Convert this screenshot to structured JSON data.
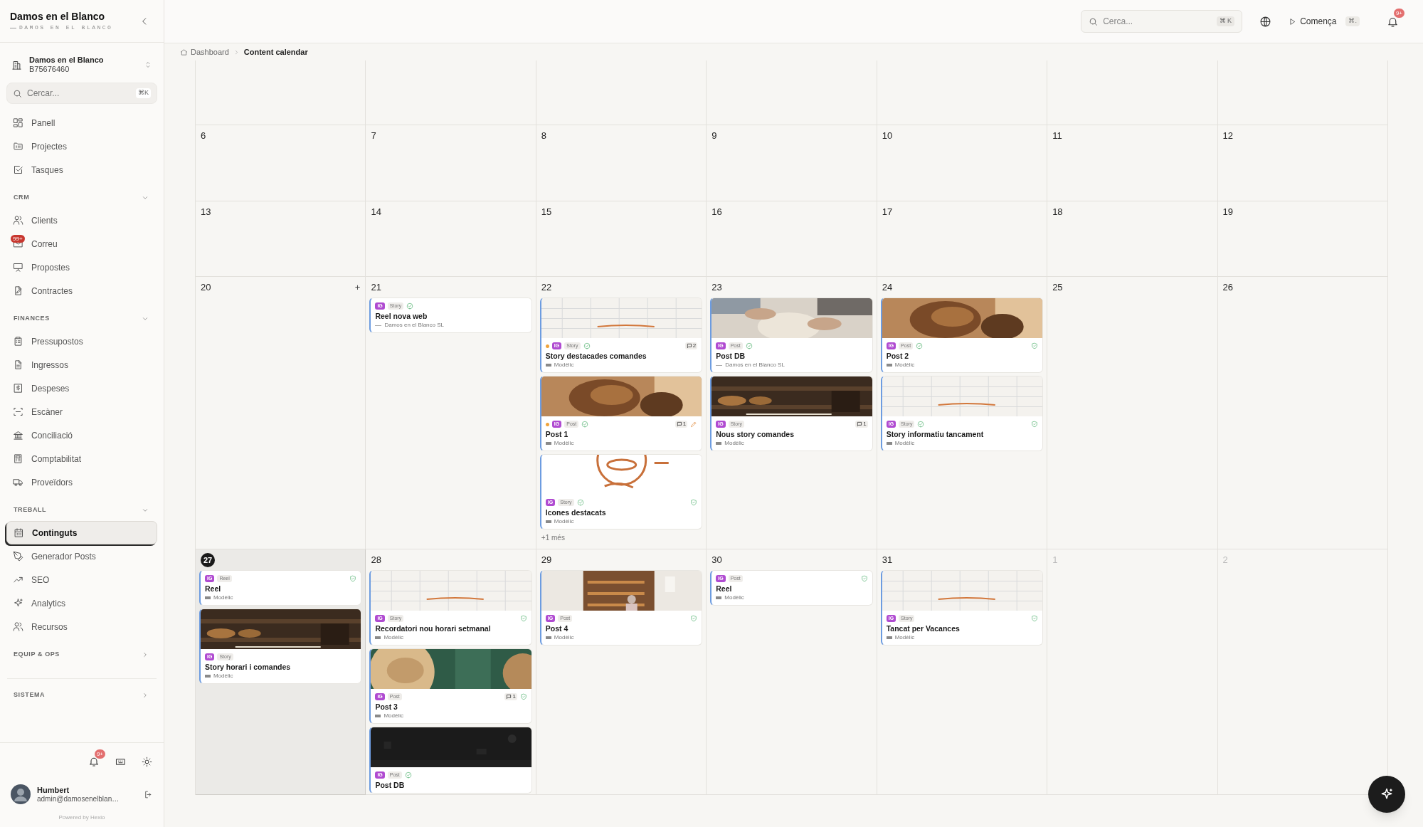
{
  "sidebar": {
    "brand": {
      "title": "Damos en el Blanco",
      "subtitle": "DAMOS EN EL BLANCO"
    },
    "org": {
      "name": "Damos en el Blanco",
      "id": "B75676460"
    },
    "search": {
      "placeholder": "Cercar...",
      "shortcut": "⌘K"
    },
    "items": [
      {
        "label": "Panell",
        "selected": false
      },
      {
        "label": "Projectes",
        "selected": false
      },
      {
        "label": "Tasques",
        "selected": false
      }
    ],
    "sections": [
      {
        "title": "CRM",
        "expanded": true,
        "items": [
          {
            "label": "Clients",
            "selected": false
          },
          {
            "label": "Correu",
            "selected": false,
            "badge": "99+"
          },
          {
            "label": "Propostes",
            "selected": false
          },
          {
            "label": "Contractes",
            "selected": false
          }
        ]
      },
      {
        "title": "FINANCES",
        "expanded": true,
        "items": [
          {
            "label": "Pressupostos",
            "selected": false
          },
          {
            "label": "Ingressos",
            "selected": false
          },
          {
            "label": "Despeses",
            "selected": false
          },
          {
            "label": "Escàner",
            "selected": false
          },
          {
            "label": "Conciliació",
            "selected": false
          },
          {
            "label": "Comptabilitat",
            "selected": false
          },
          {
            "label": "Proveïdors",
            "selected": false
          }
        ]
      },
      {
        "title": "TREBALL",
        "expanded": true,
        "items": [
          {
            "label": "Continguts",
            "selected": true
          },
          {
            "label": "Generador Posts",
            "selected": false
          },
          {
            "label": "SEO",
            "selected": false
          },
          {
            "label": "Analytics",
            "selected": false
          },
          {
            "label": "Recursos",
            "selected": false
          }
        ]
      },
      {
        "title": "EQUIP & OPS",
        "expanded": false
      },
      {
        "title": "SISTEMA",
        "expanded": false
      }
    ],
    "footer": {
      "notifications_badge": "9+",
      "user": {
        "name": "Humbert",
        "email": "admin@damosenelblan…"
      },
      "powered_by": "Powered by Hexio"
    }
  },
  "topbar": {
    "search": {
      "placeholder": "Cerca...",
      "shortcut": "⌘ K"
    },
    "start": {
      "label": "Comença",
      "shortcut": "⌘."
    },
    "notifications_badge": "9+"
  },
  "breadcrumb": [
    {
      "label": "Dashboard"
    },
    {
      "label": "Content calendar"
    }
  ],
  "calendar": {
    "weeks": [
      {
        "days": [
          {
            "day": "6"
          },
          {
            "day": "7"
          },
          {
            "day": "8"
          },
          {
            "day": "9"
          },
          {
            "day": "10"
          },
          {
            "day": "11"
          },
          {
            "day": "12"
          }
        ]
      },
      {
        "days": [
          {
            "day": "13"
          },
          {
            "day": "14"
          },
          {
            "day": "15"
          },
          {
            "day": "16"
          },
          {
            "day": "17"
          },
          {
            "day": "18"
          },
          {
            "day": "19"
          }
        ]
      },
      {
        "days": [
          {
            "day": "20",
            "add": "+"
          },
          {
            "day": "21",
            "cards": [
              {
                "platform": "IG",
                "type": "Story",
                "approved": true,
                "verified": false,
                "title": "Reel nova web",
                "client": {
                  "kind": "line",
                  "name": "Damos en el Blanco SL"
                }
              }
            ]
          },
          {
            "day": "22",
            "cards": [
              {
                "color": "#f0a43c",
                "platform": "IG",
                "type": "Story",
                "approved": true,
                "comments": "2",
                "verified": false,
                "title": "Story destacades comandes",
                "client": {
                  "kind": "logo",
                  "name": "Modèlic"
                }
              },
              {
                "color": "#f0a43c",
                "platform": "IG",
                "type": "Post",
                "approved": true,
                "comments": "1",
                "edited": true,
                "verified": false,
                "title": "Post 1",
                "client": {
                  "kind": "logo",
                  "name": "Modèlic"
                }
              },
              {
                "platform": "IG",
                "type": "Story",
                "approved": true,
                "verified": true,
                "title": "Icones destacats",
                "client": {
                  "kind": "logo",
                  "name": "Modèlic"
                }
              }
            ],
            "more": "+1 més"
          },
          {
            "day": "23",
            "cards": [
              {
                "platform": "IG",
                "type": "Post",
                "approved": true,
                "verified": false,
                "title": "Post DB",
                "client": {
                  "kind": "line",
                  "name": "Damos en el Blanco SL"
                }
              },
              {
                "platform": "IG",
                "type": "Story",
                "approved": false,
                "comments": "1",
                "verified": false,
                "title": "Nous story comandes",
                "client": {
                  "kind": "logo",
                  "name": "Modèlic"
                }
              }
            ]
          },
          {
            "day": "24",
            "cards": [
              {
                "platform": "IG",
                "type": "Post",
                "approved": true,
                "verified": true,
                "title": "Post 2",
                "client": {
                  "kind": "logo",
                  "name": "Modèlic"
                }
              },
              {
                "platform": "IG",
                "type": "Story",
                "approved": true,
                "verified": true,
                "title": "Story informatiu tancament",
                "client": {
                  "kind": "logo",
                  "name": "Modèlic"
                }
              }
            ]
          },
          {
            "day": "25"
          },
          {
            "day": "26"
          }
        ]
      },
      {
        "days": [
          {
            "day": "27",
            "today": true,
            "selected": true,
            "cards": [
              {
                "platform": "IG",
                "type": "Reel",
                "approved": false,
                "verified": true,
                "title": "Reel",
                "client": {
                  "kind": "logo",
                  "name": "Modèlic"
                }
              },
              {
                "platform": "IG",
                "type": "Story",
                "approved": false,
                "verified": false,
                "title": "Story horari i comandes",
                "client": {
                  "kind": "logo",
                  "name": "Modèlic"
                }
              }
            ]
          },
          {
            "day": "28",
            "cards": [
              {
                "platform": "IG",
                "type": "Story",
                "approved": false,
                "verified": true,
                "title": "Recordatori nou horari setmanal",
                "client": {
                  "kind": "logo",
                  "name": "Modèlic"
                }
              },
              {
                "platform": "IG",
                "type": "Post",
                "approved": false,
                "comments": "1",
                "verified": true,
                "title": "Post 3",
                "client": {
                  "kind": "logo",
                  "name": "Modèlic"
                }
              },
              {
                "platform": "IG",
                "type": "Post",
                "approved": true,
                "verified": false,
                "title": "Post DB"
              }
            ]
          },
          {
            "day": "29",
            "cards": [
              {
                "platform": "IG",
                "type": "Post",
                "approved": false,
                "verified": true,
                "title": "Post 4",
                "client": {
                  "kind": "logo",
                  "name": "Modèlic"
                }
              }
            ]
          },
          {
            "day": "30",
            "cards": [
              {
                "platform": "IG",
                "type": "Post",
                "approved": false,
                "verified": true,
                "title": "Reel",
                "client": {
                  "kind": "logo",
                  "name": "Modèlic"
                }
              }
            ]
          },
          {
            "day": "31",
            "cards": [
              {
                "platform": "IG",
                "type": "Story",
                "approved": false,
                "verified": true,
                "title": "Tancat per Vacances",
                "client": {
                  "kind": "logo",
                  "name": "Modèlic"
                }
              }
            ]
          },
          {
            "day": "1",
            "outside": true
          },
          {
            "day": "2",
            "outside": true
          }
        ]
      }
    ]
  }
}
